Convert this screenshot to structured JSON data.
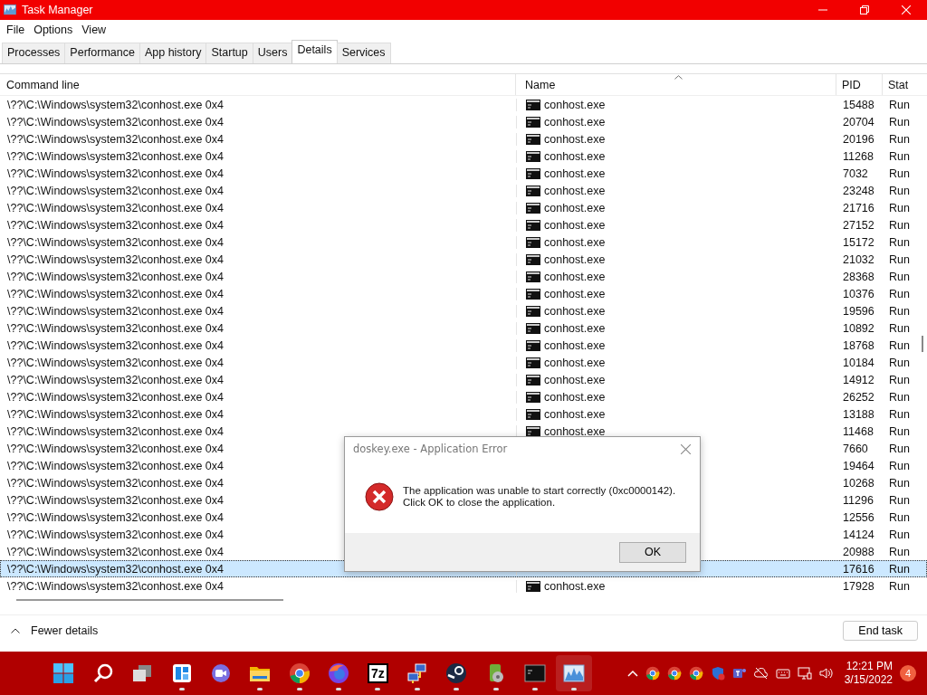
{
  "window": {
    "title": "Task Manager"
  },
  "menu": [
    "File",
    "Options",
    "View"
  ],
  "tabs": [
    {
      "label": "Processes",
      "selected": false
    },
    {
      "label": "Performance",
      "selected": false
    },
    {
      "label": "App history",
      "selected": false
    },
    {
      "label": "Startup",
      "selected": false
    },
    {
      "label": "Users",
      "selected": false
    },
    {
      "label": "Details",
      "selected": true
    },
    {
      "label": "Services",
      "selected": false
    }
  ],
  "table": {
    "columns": [
      "Command line",
      "Name",
      "PID",
      "Stat"
    ],
    "rows": [
      {
        "command": "\\??\\C:\\Windows\\system32\\conhost.exe 0x4",
        "name": "conhost.exe",
        "pid": "15488",
        "status": "Run",
        "selected": false
      },
      {
        "command": "\\??\\C:\\Windows\\system32\\conhost.exe 0x4",
        "name": "conhost.exe",
        "pid": "20704",
        "status": "Run",
        "selected": false
      },
      {
        "command": "\\??\\C:\\Windows\\system32\\conhost.exe 0x4",
        "name": "conhost.exe",
        "pid": "20196",
        "status": "Run",
        "selected": false
      },
      {
        "command": "\\??\\C:\\Windows\\system32\\conhost.exe 0x4",
        "name": "conhost.exe",
        "pid": "11268",
        "status": "Run",
        "selected": false
      },
      {
        "command": "\\??\\C:\\Windows\\system32\\conhost.exe 0x4",
        "name": "conhost.exe",
        "pid": "7032",
        "status": "Run",
        "selected": false
      },
      {
        "command": "\\??\\C:\\Windows\\system32\\conhost.exe 0x4",
        "name": "conhost.exe",
        "pid": "23248",
        "status": "Run",
        "selected": false
      },
      {
        "command": "\\??\\C:\\Windows\\system32\\conhost.exe 0x4",
        "name": "conhost.exe",
        "pid": "21716",
        "status": "Run",
        "selected": false
      },
      {
        "command": "\\??\\C:\\Windows\\system32\\conhost.exe 0x4",
        "name": "conhost.exe",
        "pid": "27152",
        "status": "Run",
        "selected": false
      },
      {
        "command": "\\??\\C:\\Windows\\system32\\conhost.exe 0x4",
        "name": "conhost.exe",
        "pid": "15172",
        "status": "Run",
        "selected": false
      },
      {
        "command": "\\??\\C:\\Windows\\system32\\conhost.exe 0x4",
        "name": "conhost.exe",
        "pid": "21032",
        "status": "Run",
        "selected": false
      },
      {
        "command": "\\??\\C:\\Windows\\system32\\conhost.exe 0x4",
        "name": "conhost.exe",
        "pid": "28368",
        "status": "Run",
        "selected": false
      },
      {
        "command": "\\??\\C:\\Windows\\system32\\conhost.exe 0x4",
        "name": "conhost.exe",
        "pid": "10376",
        "status": "Run",
        "selected": false
      },
      {
        "command": "\\??\\C:\\Windows\\system32\\conhost.exe 0x4",
        "name": "conhost.exe",
        "pid": "19596",
        "status": "Run",
        "selected": false
      },
      {
        "command": "\\??\\C:\\Windows\\system32\\conhost.exe 0x4",
        "name": "conhost.exe",
        "pid": "10892",
        "status": "Run",
        "selected": false
      },
      {
        "command": "\\??\\C:\\Windows\\system32\\conhost.exe 0x4",
        "name": "conhost.exe",
        "pid": "18768",
        "status": "Run",
        "selected": false
      },
      {
        "command": "\\??\\C:\\Windows\\system32\\conhost.exe 0x4",
        "name": "conhost.exe",
        "pid": "10184",
        "status": "Run",
        "selected": false
      },
      {
        "command": "\\??\\C:\\Windows\\system32\\conhost.exe 0x4",
        "name": "conhost.exe",
        "pid": "14912",
        "status": "Run",
        "selected": false
      },
      {
        "command": "\\??\\C:\\Windows\\system32\\conhost.exe 0x4",
        "name": "conhost.exe",
        "pid": "26252",
        "status": "Run",
        "selected": false
      },
      {
        "command": "\\??\\C:\\Windows\\system32\\conhost.exe 0x4",
        "name": "conhost.exe",
        "pid": "13188",
        "status": "Run",
        "selected": false
      },
      {
        "command": "\\??\\C:\\Windows\\system32\\conhost.exe 0x4",
        "name": "conhost.exe",
        "pid": "11468",
        "status": "Run",
        "selected": false
      },
      {
        "command": "\\??\\C:\\Windows\\system32\\conhost.exe 0x4",
        "pid": "7660",
        "status": "Run",
        "selected": false
      },
      {
        "command": "\\??\\C:\\Windows\\system32\\conhost.exe 0x4",
        "pid": "19464",
        "status": "Run",
        "selected": false
      },
      {
        "command": "\\??\\C:\\Windows\\system32\\conhost.exe 0x4",
        "pid": "10268",
        "status": "Run",
        "selected": false
      },
      {
        "command": "\\??\\C:\\Windows\\system32\\conhost.exe 0x4",
        "pid": "11296",
        "status": "Run",
        "selected": false
      },
      {
        "command": "\\??\\C:\\Windows\\system32\\conhost.exe 0x4",
        "pid": "12556",
        "status": "Run",
        "selected": false
      },
      {
        "command": "\\??\\C:\\Windows\\system32\\conhost.exe 0x4",
        "pid": "14124",
        "status": "Run",
        "selected": false
      },
      {
        "command": "\\??\\C:\\Windows\\system32\\conhost.exe 0x4",
        "pid": "20988",
        "status": "Run",
        "selected": false
      },
      {
        "command": "\\??\\C:\\Windows\\system32\\conhost.exe 0x4",
        "pid": "17616",
        "status": "Run",
        "selected": true
      },
      {
        "command": "\\??\\C:\\Windows\\system32\\conhost.exe 0x4",
        "name": "conhost.exe",
        "pid": "17928",
        "status": "Run",
        "selected": false
      }
    ]
  },
  "footer": {
    "details_toggle": "Fewer details",
    "end_task": "End task"
  },
  "dialog": {
    "title": "doskey.exe - Application Error",
    "message": "The application was unable to start correctly (0xc0000142).\nClick OK to close the application.",
    "button": "OK"
  },
  "taskbar": {
    "apps": [
      {
        "kind": "start",
        "running": false
      },
      {
        "kind": "search",
        "running": false
      },
      {
        "kind": "taskview",
        "running": false
      },
      {
        "kind": "widgets",
        "running": true
      },
      {
        "kind": "chat",
        "running": false
      },
      {
        "kind": "folder",
        "running": true
      },
      {
        "kind": "browser",
        "running": true
      },
      {
        "kind": "firefox",
        "running": true
      },
      {
        "kind": "archiver",
        "label": "7z",
        "running": true
      },
      {
        "kind": "network",
        "running": true
      },
      {
        "kind": "steam",
        "running": true
      },
      {
        "kind": "app",
        "running": true
      },
      {
        "kind": "terminal",
        "running": true
      },
      {
        "kind": "monitor",
        "running": true,
        "selected": true
      }
    ],
    "tray": [
      {
        "kind": "caret"
      },
      {
        "kind": "browser"
      },
      {
        "kind": "browser"
      },
      {
        "kind": "browser"
      },
      {
        "kind": "shield"
      },
      {
        "kind": "teams"
      },
      {
        "kind": "cloud"
      },
      {
        "kind": "keyboard"
      },
      {
        "kind": "network"
      },
      {
        "kind": "speaker"
      }
    ],
    "time": "12:21 PM",
    "date": "3/15/2022",
    "badge": "4"
  }
}
